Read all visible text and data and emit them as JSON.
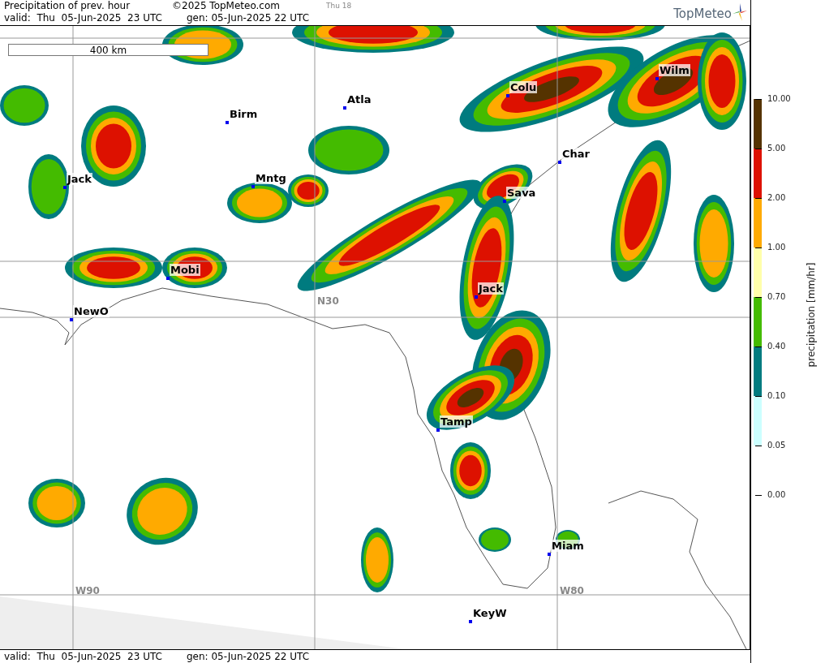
{
  "header": {
    "title": "Precipitation of prev. hour",
    "copyright": "©2025 TopMeteo.com",
    "frame": "Thu 18",
    "valid": "valid:  Thu  05-Jun-2025  23 UTC",
    "generated": "gen: 05-Jun-2025 22 UTC",
    "logo": "TopMeteo"
  },
  "map": {
    "scale": "400 km",
    "grid_labels": [
      "N30",
      "W90",
      "W80"
    ],
    "cities": [
      "Wilm",
      "Colu",
      "Atla",
      "Birm",
      "Char",
      "Jack",
      "Mntg",
      "Sava",
      "Mobi",
      "Jack",
      "NewO",
      "Tamp",
      "Miam",
      "KeyW"
    ]
  },
  "legend": {
    "title": "precipitation [mm/hr]",
    "bands": [
      {
        "color": "#553300"
      },
      {
        "color": "#dd1100"
      },
      {
        "color": "#ffaa00"
      },
      {
        "color": "#ffffaa"
      },
      {
        "color": "#44bb00"
      },
      {
        "color": "#007b7f"
      },
      {
        "color": "#ccffff"
      }
    ],
    "ticks": [
      "10.00",
      "5.00",
      "2.00",
      "1.00",
      "0.70",
      "0.40",
      "0.10",
      "0.05",
      "0.00"
    ]
  },
  "footer": {
    "valid": "valid:  Thu  05-Jun-2025  23 UTC",
    "generated": "gen: 05-Jun-2025 22 UTC"
  }
}
